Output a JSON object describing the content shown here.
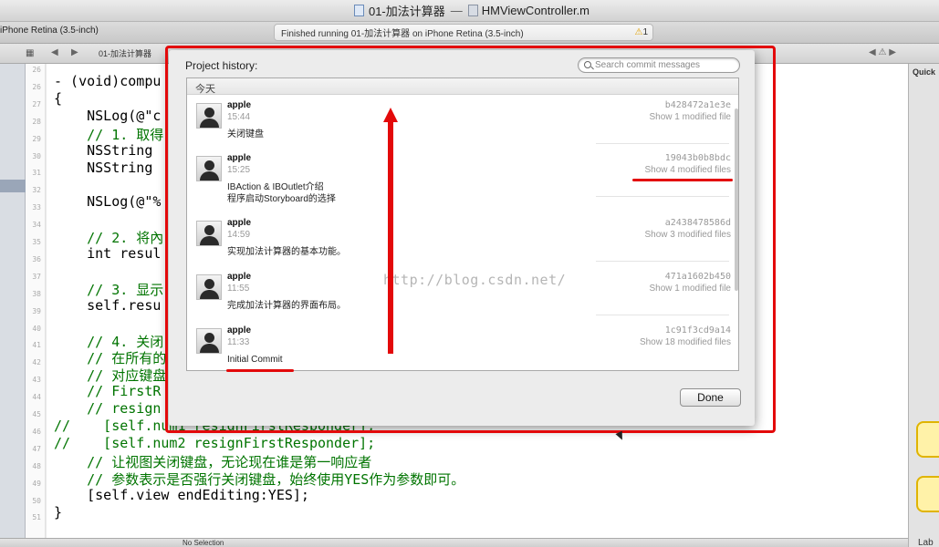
{
  "window": {
    "title_project": "01-加法计算器",
    "title_sep": "—",
    "title_file": "HMViewController.m"
  },
  "toolbar": {
    "scheme": "iPhone Retina (3.5-inch)",
    "status": "Finished running 01-加法计算器 on iPhone Retina (3.5-inch)",
    "warning_count": "1"
  },
  "jumpbar": {
    "file": "01-加法计算器"
  },
  "editor": {
    "line_numbers": [
      "26",
      "26",
      "27",
      "28",
      "29",
      "30",
      "31",
      "32",
      "33",
      "34",
      "35",
      "36",
      "37",
      "38",
      "39",
      "40",
      "41",
      "42",
      "43",
      "44",
      "45",
      "46",
      "47",
      "48",
      "49",
      "50",
      "51"
    ],
    "lines": [
      "- (void)compu",
      "{",
      "    NSLog(@\"c",
      "    // 1. 取得",
      "    NSString",
      "    NSString",
      "",
      "    NSLog(@\"%",
      "",
      "    // 2. 将內",
      "    int resul",
      "",
      "    // 3. 显示",
      "    self.resu",
      "",
      "    // 4. 关闭",
      "    // 在所有的",
      "    // 对应键盘",
      "    // FirstR",
      "    // resign",
      "//    [self.num1 resignFirstResponder];",
      "//    [self.num2 resignFirstResponder];",
      "    // 让视图关闭键盘，无论现在谁是第一响应者",
      "    // 参数表示是否强行关闭键盘，始终使用YES作为参数即可。",
      "    [self.view endEditing:YES];",
      "}",
      ""
    ]
  },
  "sheet": {
    "title": "Project history:",
    "search_placeholder": "Search commit messages",
    "section_header": "今天",
    "done_label": "Done",
    "commits": [
      {
        "author": "apple",
        "time": "15:44",
        "message": "关闭键盘",
        "hash": "b428472a1e3e",
        "files": "Show 1 modified file"
      },
      {
        "author": "apple",
        "time": "15:25",
        "message": "IBAction & IBOutlet介绍\n程序启动Storyboard的选择",
        "hash": "19043b0b8bdc",
        "files": "Show 4 modified files"
      },
      {
        "author": "apple",
        "time": "14:59",
        "message": "实现加法计算器的基本功能。",
        "hash": "a2438478586d",
        "files": "Show 3 modified files"
      },
      {
        "author": "apple",
        "time": "11:55",
        "message": "完成加法计算器的界面布局。",
        "hash": "471a1602b450",
        "files": "Show 1 modified file"
      },
      {
        "author": "apple",
        "time": "11:33",
        "message": "Initial Commit",
        "hash": "1c91f3cd9a14",
        "files": "Show 18 modified files"
      }
    ]
  },
  "inspector": {
    "quick": "Quick",
    "lab": "Lab"
  },
  "statusbar": {
    "selection": "No Selection"
  },
  "watermark": "http://blog.csdn.net/",
  "colors": {
    "annotation_red": "#e3090a",
    "keyword": "#b40062",
    "comment": "#007400"
  }
}
